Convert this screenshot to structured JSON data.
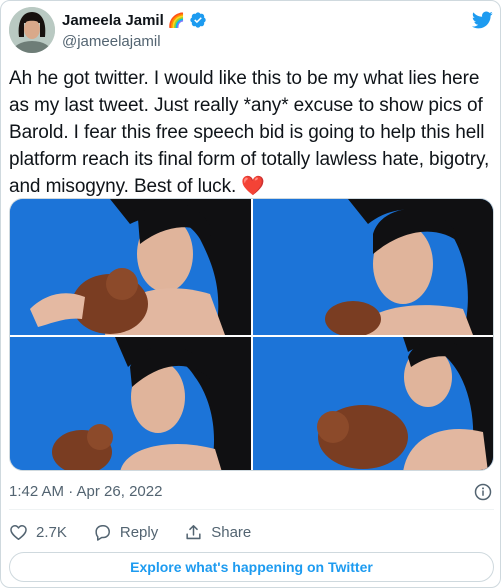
{
  "author": {
    "name": "Jameela Jamil",
    "badge_emoji": "🌈",
    "handle": "@jameelajamil"
  },
  "tweet": {
    "text": "Ah he got twitter. I would like this to be my what lies here as my last tweet. Just really *any* excuse to show pics of Barold. I fear this free speech bid is going to help this hell platform reach its final form of totally lawless hate, bigotry, and misogyny. Best of luck. ❤️",
    "timestamp": "1:42 AM · Apr 26, 2022"
  },
  "actions": {
    "like_count": "2.7K",
    "reply_label": "Reply",
    "share_label": "Share"
  },
  "explore_label": "Explore what's happening on Twitter",
  "colors": {
    "twitter_blue": "#1d9bf0",
    "verified_blue": "#1d9bf0",
    "heart_red": "#e0245e",
    "photo_background_blue": "#1b73d6"
  },
  "icons": [
    "twitter-logo-icon",
    "verified-badge-icon",
    "info-icon",
    "heart-icon",
    "reply-icon",
    "share-icon"
  ]
}
